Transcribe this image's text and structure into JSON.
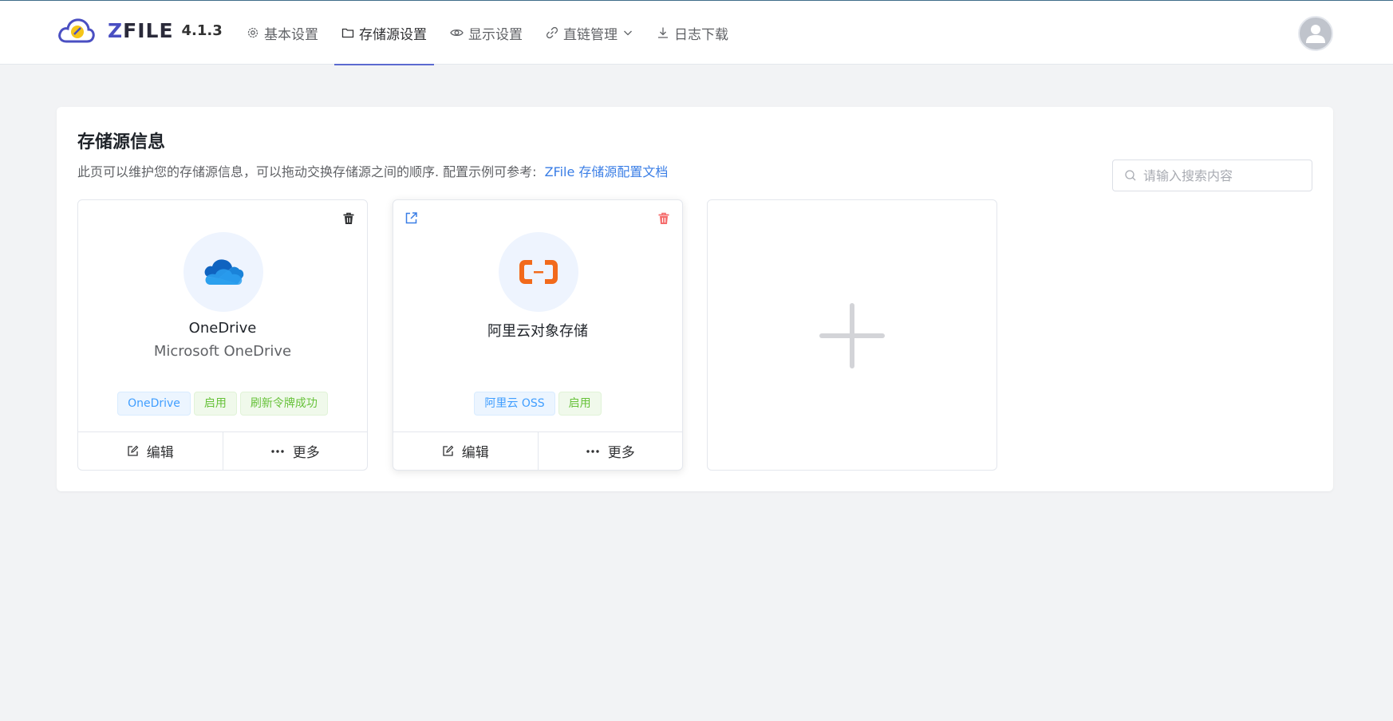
{
  "header": {
    "logo_text_prefix": "Z",
    "logo_text_rest": "FILE",
    "version": "4.1.3",
    "nav": [
      {
        "label": "基本设置",
        "icon": "gear-icon"
      },
      {
        "label": "存储源设置",
        "icon": "folder-icon",
        "active": true
      },
      {
        "label": "显示设置",
        "icon": "eye-icon"
      },
      {
        "label": "直链管理",
        "icon": "link-icon",
        "dropdown": true
      },
      {
        "label": "日志下载",
        "icon": "download-icon"
      }
    ],
    "avatar_icon": "user-avatar-icon"
  },
  "main": {
    "title": "存储源信息",
    "description": "此页可以维护您的存储源信息，可以拖动交换存储源之间的顺序. 配置示例可参考:",
    "doc_link": "ZFile 存储源配置文档",
    "search_placeholder": "请输入搜索内容"
  },
  "storages": [
    {
      "name": "OneDrive",
      "subtitle": "Microsoft OneDrive",
      "icon": "onedrive-icon",
      "tags": [
        "OneDrive",
        "启用",
        "刷新令牌成功"
      ],
      "edit_label": "编辑",
      "more_label": "更多"
    },
    {
      "name": "阿里云对象存储",
      "subtitle": "",
      "icon": "aliyun-icon",
      "tags": [
        "阿里云 OSS",
        "启用"
      ],
      "edit_label": "编辑",
      "more_label": "更多"
    }
  ],
  "add_card": {
    "icon": "plus-icon"
  },
  "colors": {
    "accent": "#5b6ad0",
    "link": "#3a7ee6",
    "tag_blue": "#409eff",
    "tag_green": "#67c23a",
    "delete_red": "#f56c6c"
  }
}
